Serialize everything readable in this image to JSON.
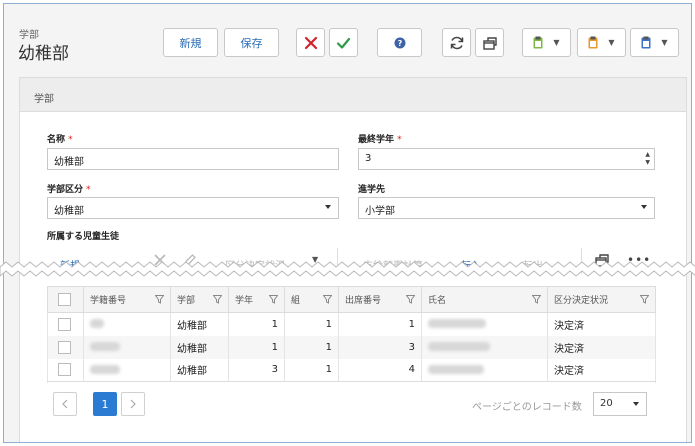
{
  "header": {
    "breadcrumb": "学部",
    "title": "幼稚部",
    "new_label": "新規",
    "save_label": "保存"
  },
  "section": {
    "title": "学部"
  },
  "form": {
    "name_label": "名称",
    "name_value": "幼稚部",
    "final_grade_label": "最終学年",
    "final_grade_value": "3",
    "dept_type_label": "学部区分",
    "dept_type_value": "幼稚部",
    "next_dept_label": "進学先",
    "next_dept_value": "小学部",
    "required_mark": "*"
  },
  "students": {
    "section_label": "所属する児童生徒",
    "toolbar": {
      "new": "新規",
      "status": "区分決定状況",
      "recalc": "支給額再計算",
      "transfer_in": "転入...",
      "transfer_out": "転出..."
    },
    "columns": [
      "学籍番号",
      "学部",
      "学年",
      "組",
      "出席番号",
      "氏名",
      "区分決定状況"
    ],
    "rows": [
      {
        "dept": "幼稚部",
        "grade": "1",
        "class": "1",
        "seat": "1",
        "status": "決定済"
      },
      {
        "dept": "幼稚部",
        "grade": "1",
        "class": "1",
        "seat": "3",
        "status": "決定済"
      },
      {
        "dept": "幼稚部",
        "grade": "3",
        "class": "1",
        "seat": "4",
        "status": "決定済"
      }
    ]
  },
  "pager": {
    "current_page": "1",
    "page_size_label": "ページごとのレコード数",
    "page_size": "20"
  },
  "colors": {
    "accent": "#2a6db5",
    "cancel_red": "#d0232a",
    "confirm_green": "#2e9a4a",
    "required": "#dd2222"
  }
}
